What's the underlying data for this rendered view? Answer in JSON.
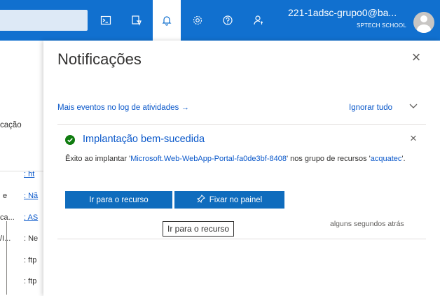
{
  "header": {
    "user_email": "221-1adsc-grupo0@ba...",
    "user_org": "SPTECH SCHOOL",
    "icons": [
      "cloud-shell-icon",
      "directory-filter-icon",
      "notifications-bell-icon",
      "settings-gear-icon",
      "help-question-icon",
      "feedback-icon"
    ]
  },
  "left_panel": {
    "fragment_label": "cação",
    "rows": [
      {
        "label": "",
        "value": ": ht"
      },
      {
        "label": "e",
        "value": ": Nã"
      },
      {
        "label": "ca...",
        "value": ": AS"
      },
      {
        "label": "/I...",
        "value": ": Ne"
      },
      {
        "label": "",
        "value": ": ftp"
      },
      {
        "label": "",
        "value": ": ftp"
      }
    ]
  },
  "notifications": {
    "title": "Notificações",
    "close_icon": "×",
    "activity_log_link": "Mais eventos no log de atividades →",
    "dismiss_all": "Ignorar tudo",
    "items": [
      {
        "title": "Implantação bem-sucedida",
        "status_color": "#107c10",
        "body_prefix": "Êxito ao implantar '",
        "resource_link": "Microsoft.Web-WebApp-Portal-fa0de3bf-8408",
        "body_middle": "' nos grupo de recursos '",
        "group_link": "acquatec",
        "body_suffix": "'.",
        "primary_button": "Ir para o recurso",
        "pin_button": "Fixar no painel",
        "timestamp": "alguns segundos atrás"
      }
    ],
    "tooltip": "Ir para o recurso"
  },
  "colors": {
    "topbar": "#1170cf",
    "primary_button": "#0f6cbd",
    "link": "#0a58ca"
  }
}
